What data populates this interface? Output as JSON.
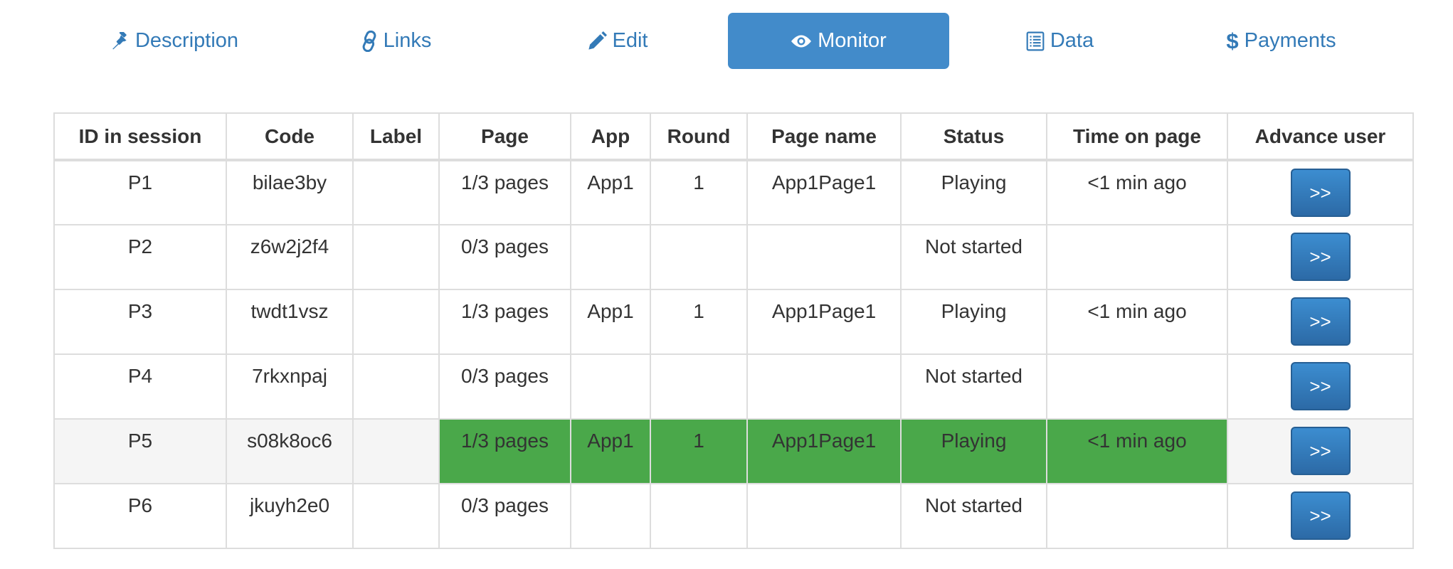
{
  "tabs": [
    {
      "label": "Description",
      "icon": "pushpin-icon",
      "active": false
    },
    {
      "label": "Links",
      "icon": "link-icon",
      "active": false
    },
    {
      "label": "Edit",
      "icon": "pencil-icon",
      "active": false
    },
    {
      "label": "Monitor",
      "icon": "eye-icon",
      "active": true
    },
    {
      "label": "Data",
      "icon": "list-icon",
      "active": false
    },
    {
      "label": "Payments",
      "icon": "dollar-icon",
      "active": false
    }
  ],
  "colors": {
    "link": "#337ab7",
    "active_tab": "#428bca",
    "highlight_green": "#4aa84a",
    "highlight_row": "#f5f5f5",
    "button": "#2e6da4"
  },
  "table": {
    "headers": [
      "ID in session",
      "Code",
      "Label",
      "Page",
      "App",
      "Round",
      "Page name",
      "Status",
      "Time on page",
      "Advance user"
    ],
    "advance_button_label": ">>",
    "rows": [
      {
        "id": "P1",
        "code": "bilae3by",
        "label": "",
        "page": "1/3 pages",
        "app": "App1",
        "round": "1",
        "page_name": "App1Page1",
        "status": "Playing",
        "time": "<1 min ago"
      },
      {
        "id": "P2",
        "code": "z6w2j2f4",
        "label": "",
        "page": "0/3 pages",
        "app": "",
        "round": "",
        "page_name": "",
        "status": "Not started",
        "time": ""
      },
      {
        "id": "P3",
        "code": "twdt1vsz",
        "label": "",
        "page": "1/3 pages",
        "app": "App1",
        "round": "1",
        "page_name": "App1Page1",
        "status": "Playing",
        "time": "<1 min ago"
      },
      {
        "id": "P4",
        "code": "7rkxnpaj",
        "label": "",
        "page": "0/3 pages",
        "app": "",
        "round": "",
        "page_name": "",
        "status": "Not started",
        "time": ""
      },
      {
        "id": "P5",
        "code": "s08k8oc6",
        "label": "",
        "page": "1/3 pages",
        "app": "App1",
        "round": "1",
        "page_name": "App1Page1",
        "status": "Playing",
        "time": "<1 min ago"
      },
      {
        "id": "P6",
        "code": "jkuyh2e0",
        "label": "",
        "page": "0/3 pages",
        "app": "",
        "round": "",
        "page_name": "",
        "status": "Not started",
        "time": ""
      }
    ]
  }
}
